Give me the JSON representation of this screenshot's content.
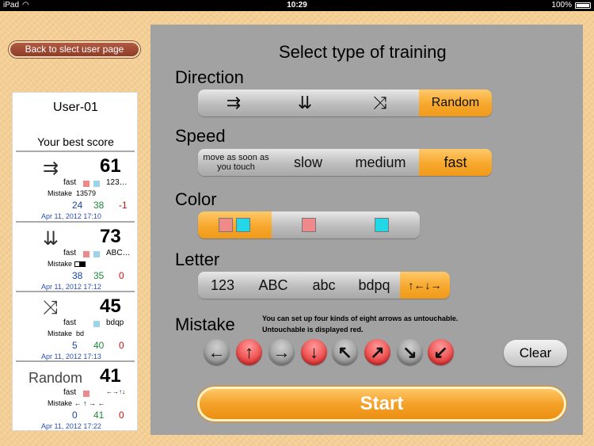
{
  "status_bar": {
    "device": "iPad",
    "time": "10:29",
    "battery": "100%"
  },
  "back_button": {
    "label": "Back to  slect user page"
  },
  "user_panel": {
    "user_name": "User-01",
    "best_score_title": "Your best score",
    "scores": [
      {
        "mode_icon": "⇉",
        "score": "61",
        "speed": "fast",
        "letter": "123…",
        "mistake_label": "Mistake",
        "mistake_value": "13579",
        "m1": "24",
        "m2": "38",
        "m3": "-1",
        "date": "Apr 11, 2012 17:10"
      },
      {
        "mode_icon": "⇊",
        "score": "73",
        "speed": "fast",
        "letter": "ABC…",
        "mistake_label": "Mistake",
        "mistake_value": "",
        "m1": "38",
        "m2": "35",
        "m3": "0",
        "date": "Apr 11, 2012 17:12"
      },
      {
        "mode_icon": "⤨",
        "score": "45",
        "speed": "fast",
        "letter": "bdqp",
        "mistake_label": "Mistake",
        "mistake_value": "bd",
        "m1": "5",
        "m2": "40",
        "m3": "0",
        "date": "Apr 11, 2012 17:13"
      },
      {
        "mode_icon": "Random",
        "score": "41",
        "speed": "fast",
        "letter": "←→↑↓",
        "mistake_label": "Mistake",
        "mistake_value": "← ↑ → ←",
        "m1": "0",
        "m2": "41",
        "m3": "0",
        "date": "Apr 11, 2012 17:22"
      }
    ]
  },
  "main": {
    "title": "Select type of training",
    "direction": {
      "label": "Direction",
      "options": [
        "⇉",
        "⇊",
        "⤨",
        "Random"
      ],
      "selected": 3
    },
    "speed": {
      "label": "Speed",
      "options": [
        "move as soon as you touch",
        "slow",
        "medium",
        "fast"
      ],
      "selected": 3
    },
    "color": {
      "label": "Color",
      "selected": 0
    },
    "letter": {
      "label": "Letter",
      "options": [
        "123",
        "ABC",
        "abc",
        "bdpq",
        "↑←↓→"
      ],
      "selected": 4
    },
    "mistake": {
      "label": "Mistake",
      "note_line1": "You can set up four kinds of eight arrows as untouchable.",
      "note_line2": "Untouchable is displayed red.",
      "arrows": [
        "←",
        "↑",
        "→",
        "↓",
        "↖",
        "↗",
        "↘",
        "↙"
      ],
      "untouchable": [
        false,
        true,
        false,
        true,
        false,
        true,
        false,
        true
      ]
    },
    "clear_label": "Clear",
    "start_label": "Start"
  },
  "colors": {
    "accent": "#f6a82d",
    "panel_gray": "#a2a2a2",
    "untouchable_red": "#e01919",
    "pink": "#f08a8a",
    "cyan": "#22d8e8"
  }
}
